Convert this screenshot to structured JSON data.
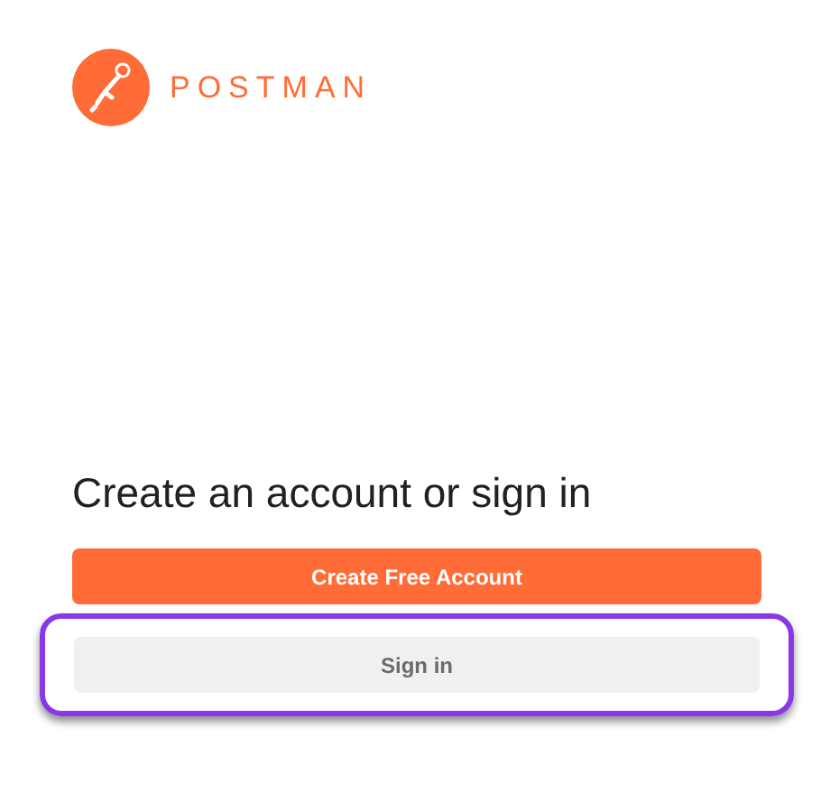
{
  "logo": {
    "wordmark": "POSTMAN"
  },
  "heading": "Create an account or sign in",
  "buttons": [
    {
      "label": "Create Free Account",
      "kind": "primary",
      "highlighted": false
    },
    {
      "label": "Sign in",
      "kind": "secondary",
      "highlighted": true
    }
  ]
}
